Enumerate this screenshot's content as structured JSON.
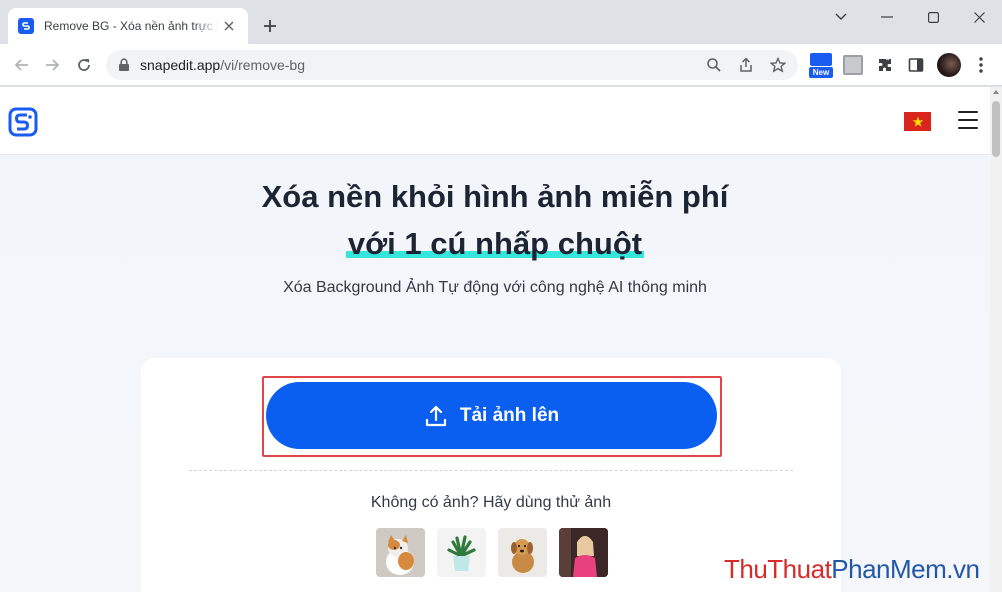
{
  "browser": {
    "tab_title": "Remove BG - Xóa nền ảnh trực tuyến",
    "url_host": "snapedit.app",
    "url_path": "/vi/remove-bg",
    "extension_badge": "New"
  },
  "site": {
    "hero_line1": "Xóa nền khỏi hình ảnh miễn phí",
    "hero_line2": "với 1 cú nhấp chuột",
    "subtitle": "Xóa Background Ảnh Tự động với công nghệ AI thông minh",
    "upload_label": "Tải ảnh lên",
    "sample_prompt": "Không có ảnh? Hãy dùng thử ảnh",
    "samples": [
      "cat",
      "potted-plant",
      "puppy",
      "woman-in-pink"
    ]
  },
  "colors": {
    "primary": "#0a5ff0",
    "highlight": "#35e6dc",
    "annotation_border": "#e0474c",
    "flag_red": "#da251d",
    "watermark_red": "#d52b2b",
    "watermark_blue": "#2358a8"
  },
  "watermark": {
    "part1": "ThuThuat",
    "part2": "PhanMem",
    "part3": ".vn"
  }
}
